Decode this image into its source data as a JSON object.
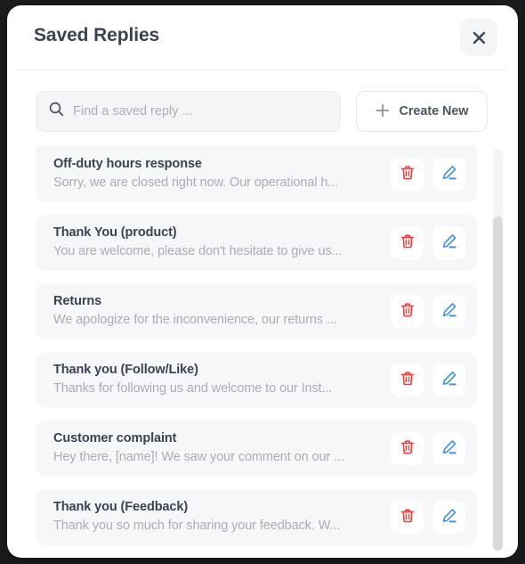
{
  "dialog": {
    "title": "Saved Replies",
    "close_icon": "close-icon"
  },
  "toolbar": {
    "search": {
      "icon": "search-icon",
      "placeholder": "Find a saved reply ...",
      "value": ""
    },
    "create_new": {
      "label": "Create New",
      "icon": "plus-icon"
    }
  },
  "list": {
    "row_actions": {
      "delete_icon": "trash-icon",
      "delete_label": "Delete",
      "edit_icon": "pencil-icon",
      "edit_label": "Edit"
    },
    "items": [
      {
        "title": "Off-duty hours response",
        "preview": "Sorry, we are closed right now. Our operational h..."
      },
      {
        "title": "Thank You (product)",
        "preview": "You are welcome, please don't hesitate to give us..."
      },
      {
        "title": "Returns",
        "preview": "We apologize for the inconvenience, our returns ..."
      },
      {
        "title": "Thank you (Follow/Like)",
        "preview": "Thanks for following us and welcome to our Inst..."
      },
      {
        "title": "Customer complaint",
        "preview": "Hey there, [name]! We saw your comment on our ..."
      },
      {
        "title": "Thank you (Feedback)",
        "preview": "Thank you so much for sharing your feedback. W..."
      }
    ]
  },
  "colors": {
    "title_text": "#3b4254",
    "preview_text": "#a8adb8",
    "card_background": "#f6f7f8",
    "delete_accent": "#f93a3a",
    "edit_accent": "#3b91e8",
    "modal_background": "#ffffff",
    "page_background": "#1c1c1e"
  },
  "scroll": {
    "orientation": "vertical",
    "thumb_position": "near-bottom"
  }
}
